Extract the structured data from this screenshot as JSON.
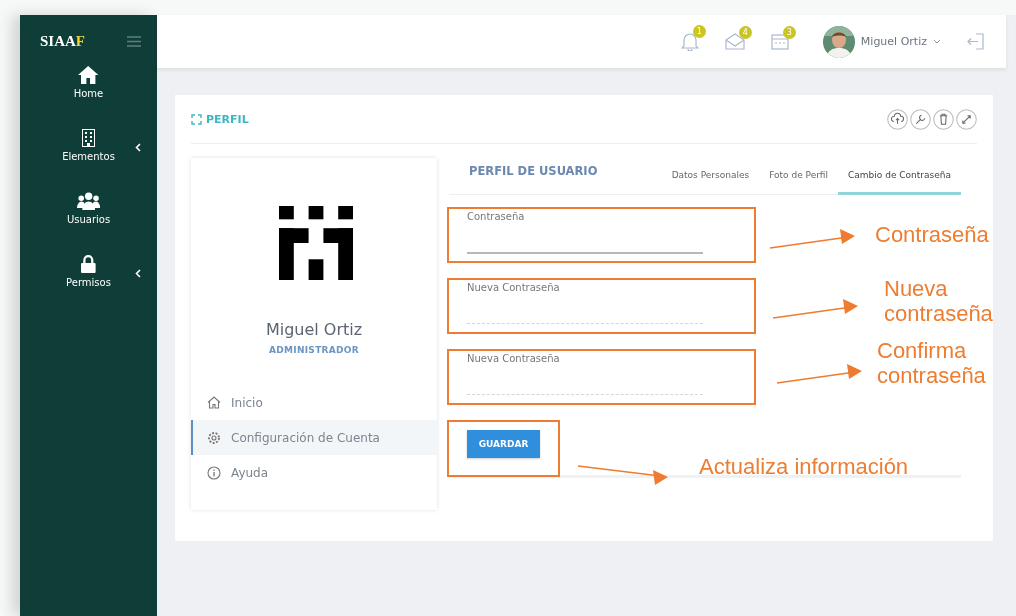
{
  "logo": {
    "text": "SIAA",
    "accent": "F"
  },
  "sidebar": {
    "items": [
      {
        "label": "Home",
        "kind": "home",
        "has_submenu": false
      },
      {
        "label": "Elementos",
        "kind": "building",
        "has_submenu": true
      },
      {
        "label": "Usuarios",
        "kind": "users",
        "has_submenu": false
      },
      {
        "label": "Permisos",
        "kind": "lock",
        "has_submenu": true
      }
    ]
  },
  "header": {
    "notifications": [
      {
        "kind": "bell",
        "count": "1"
      },
      {
        "kind": "mail",
        "count": "4"
      },
      {
        "kind": "calendar",
        "count": "3"
      }
    ],
    "user_name": "Miguel Ortiz"
  },
  "card": {
    "title": "PERFIL",
    "profile": {
      "name": "Miguel Ortiz",
      "role": "ADMINISTRADOR"
    },
    "menu": [
      {
        "label": "Inicio",
        "kind": "home",
        "selected": false
      },
      {
        "label": "Configuración de Cuenta",
        "kind": "gear",
        "selected": true
      },
      {
        "label": "Ayuda",
        "kind": "info",
        "selected": false
      }
    ],
    "section_title": "PERFIL DE USUARIO",
    "tabs": [
      {
        "label": "Datos Personales",
        "selected": false
      },
      {
        "label": "Foto de Perfil",
        "selected": false
      },
      {
        "label": "Cambio de Contraseña",
        "selected": true
      }
    ],
    "fields": [
      {
        "label": "Contraseña",
        "focused": true
      },
      {
        "label": "Nueva Contraseña",
        "focused": false
      },
      {
        "label": "Nueva Contraseña",
        "focused": false
      }
    ],
    "save_button": "GUARDAR"
  },
  "annotations": [
    {
      "text": "Contraseña"
    },
    {
      "text": "Nueva contraseña"
    },
    {
      "text": "Confirma contraseña"
    },
    {
      "text": "Actualiza información"
    }
  ]
}
